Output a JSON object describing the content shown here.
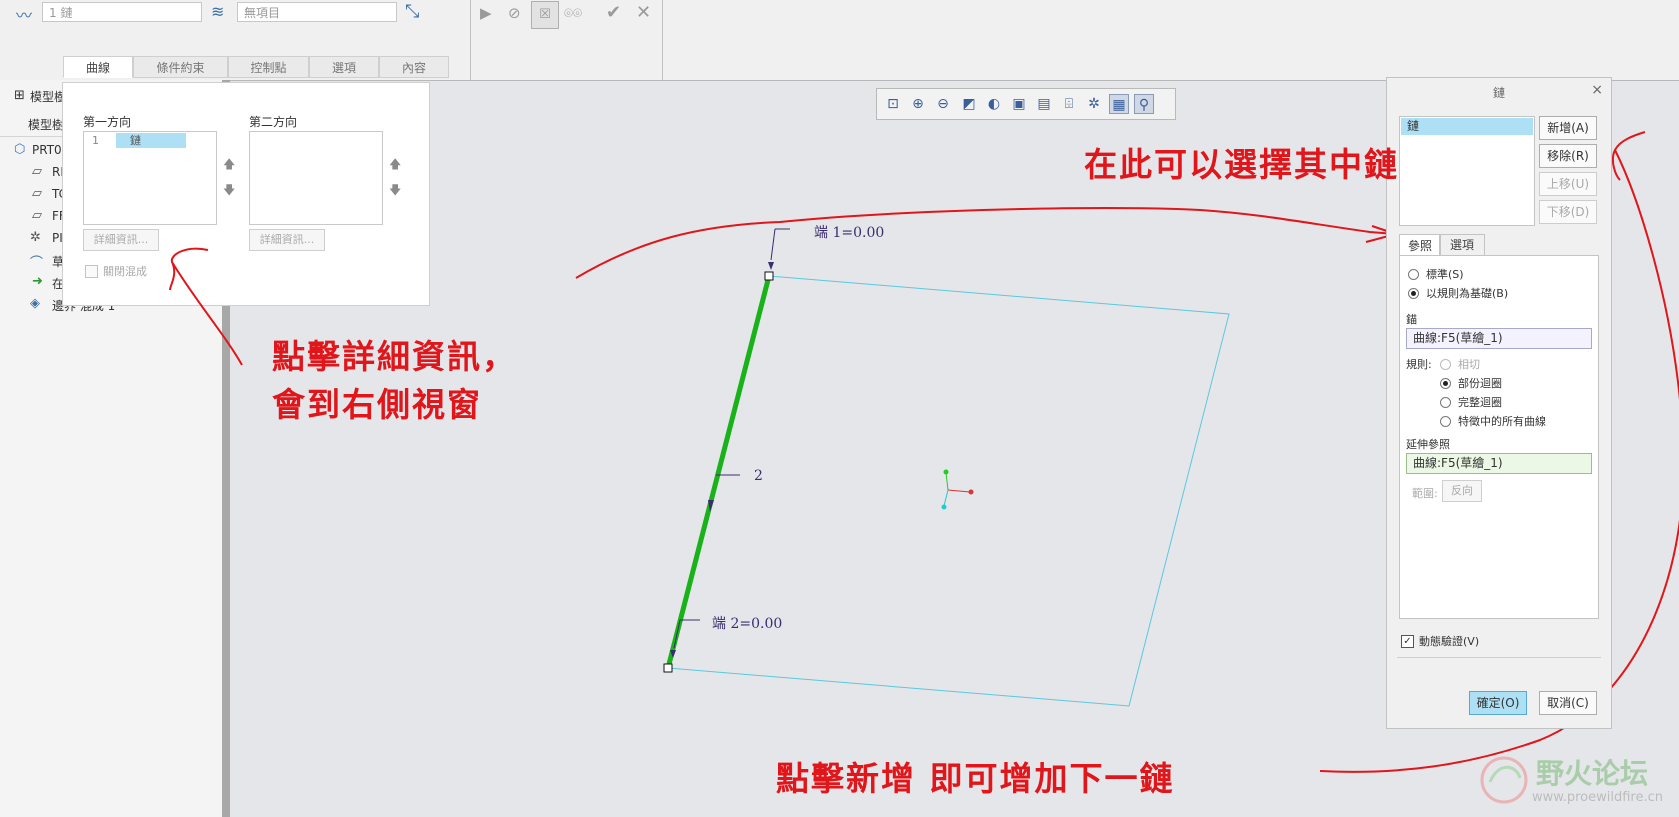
{
  "ribbon": {
    "chain_field": "1 鏈",
    "items_field": "無項目",
    "tabs": [
      {
        "label": "曲線"
      },
      {
        "label": "條件約束"
      },
      {
        "label": "控制點"
      },
      {
        "label": "選項"
      },
      {
        "label": "內容"
      }
    ]
  },
  "tree": {
    "header1": "模型樹",
    "header2": "模型樹",
    "items": [
      {
        "label": "PRT0",
        "icon": "part-icon"
      },
      {
        "label": "RI",
        "icon": "plane-icon"
      },
      {
        "label": "TC",
        "icon": "plane-icon"
      },
      {
        "label": "FF",
        "icon": "plane-icon"
      },
      {
        "label": "PI",
        "icon": "csys-icon"
      },
      {
        "label": "草",
        "icon": "sketch-icon"
      },
      {
        "label": "在",
        "icon": "insert-here-icon"
      },
      {
        "label": "邊界 混成 1",
        "icon": "boundary-blend-icon"
      }
    ]
  },
  "curve_panel": {
    "dir1_label": "第一方向",
    "dir2_label": "第二方向",
    "dir1_row_index": "1",
    "dir1_row_value": "鏈",
    "details_btn1": "詳細資訊...",
    "details_btn2": "詳細資訊...",
    "close_blend_label": "關閉混成"
  },
  "dialog": {
    "title": "鏈",
    "list_item": "鏈",
    "btn_add": "新增(A)",
    "btn_remove": "移除(R)",
    "btn_up": "上移(U)",
    "btn_down": "下移(D)",
    "tab_ref": "參照",
    "tab_options": "選項",
    "radio_standard": "標準(S)",
    "radio_rule": "以規則為基礎(B)",
    "anchor_label": "錨",
    "anchor_value": "曲線:F5(草繪_1)",
    "rule_label": "規則:",
    "rule_tangent": "相切",
    "rule_partial": "部份迴圈",
    "rule_full": "完整迴圈",
    "rule_all": "特徵中的所有曲線",
    "extend_label": "延伸參照",
    "extend_value": "曲線:F5(草繪_1)",
    "range_label": "範圍:",
    "reverse_btn": "反向",
    "dynamic_label": "動態驗證(V)",
    "ok_btn": "確定(O)",
    "cancel_btn": "取消(C)"
  },
  "canvas": {
    "end1": "端 1=0.00",
    "end2": "端 2=0.00",
    "mid_label": "2"
  },
  "annotations": {
    "note_details_line1": "點擊詳細資訊，",
    "note_details_line2": "會到右側視窗",
    "note_select": "在此可以選擇其中鏈",
    "note_add": "點擊新增  即可增加下一鏈"
  },
  "watermark": {
    "text": "野火论坛",
    "url": "www.proewildfire.cn"
  },
  "colors": {
    "annotation": "#e0161a",
    "selected_edge": "#19b219",
    "surface_edge": "#5bc8dc",
    "dialog_selection": "#aee0f5"
  }
}
